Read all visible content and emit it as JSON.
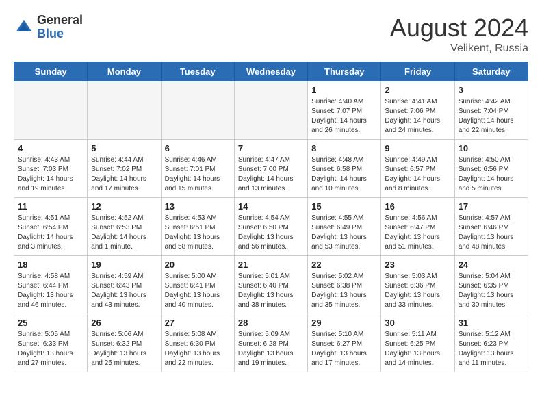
{
  "header": {
    "logo_general": "General",
    "logo_blue": "Blue",
    "title": "August 2024",
    "subtitle": "Velikent, Russia"
  },
  "weekdays": [
    "Sunday",
    "Monday",
    "Tuesday",
    "Wednesday",
    "Thursday",
    "Friday",
    "Saturday"
  ],
  "weeks": [
    [
      {
        "day": "",
        "sunrise": "",
        "sunset": "",
        "daylight": ""
      },
      {
        "day": "",
        "sunrise": "",
        "sunset": "",
        "daylight": ""
      },
      {
        "day": "",
        "sunrise": "",
        "sunset": "",
        "daylight": ""
      },
      {
        "day": "",
        "sunrise": "",
        "sunset": "",
        "daylight": ""
      },
      {
        "day": "1",
        "sunrise": "Sunrise: 4:40 AM",
        "sunset": "Sunset: 7:07 PM",
        "daylight": "Daylight: 14 hours and 26 minutes."
      },
      {
        "day": "2",
        "sunrise": "Sunrise: 4:41 AM",
        "sunset": "Sunset: 7:06 PM",
        "daylight": "Daylight: 14 hours and 24 minutes."
      },
      {
        "day": "3",
        "sunrise": "Sunrise: 4:42 AM",
        "sunset": "Sunset: 7:04 PM",
        "daylight": "Daylight: 14 hours and 22 minutes."
      }
    ],
    [
      {
        "day": "4",
        "sunrise": "Sunrise: 4:43 AM",
        "sunset": "Sunset: 7:03 PM",
        "daylight": "Daylight: 14 hours and 19 minutes."
      },
      {
        "day": "5",
        "sunrise": "Sunrise: 4:44 AM",
        "sunset": "Sunset: 7:02 PM",
        "daylight": "Daylight: 14 hours and 17 minutes."
      },
      {
        "day": "6",
        "sunrise": "Sunrise: 4:46 AM",
        "sunset": "Sunset: 7:01 PM",
        "daylight": "Daylight: 14 hours and 15 minutes."
      },
      {
        "day": "7",
        "sunrise": "Sunrise: 4:47 AM",
        "sunset": "Sunset: 7:00 PM",
        "daylight": "Daylight: 14 hours and 13 minutes."
      },
      {
        "day": "8",
        "sunrise": "Sunrise: 4:48 AM",
        "sunset": "Sunset: 6:58 PM",
        "daylight": "Daylight: 14 hours and 10 minutes."
      },
      {
        "day": "9",
        "sunrise": "Sunrise: 4:49 AM",
        "sunset": "Sunset: 6:57 PM",
        "daylight": "Daylight: 14 hours and 8 minutes."
      },
      {
        "day": "10",
        "sunrise": "Sunrise: 4:50 AM",
        "sunset": "Sunset: 6:56 PM",
        "daylight": "Daylight: 14 hours and 5 minutes."
      }
    ],
    [
      {
        "day": "11",
        "sunrise": "Sunrise: 4:51 AM",
        "sunset": "Sunset: 6:54 PM",
        "daylight": "Daylight: 14 hours and 3 minutes."
      },
      {
        "day": "12",
        "sunrise": "Sunrise: 4:52 AM",
        "sunset": "Sunset: 6:53 PM",
        "daylight": "Daylight: 14 hours and 1 minute."
      },
      {
        "day": "13",
        "sunrise": "Sunrise: 4:53 AM",
        "sunset": "Sunset: 6:51 PM",
        "daylight": "Daylight: 13 hours and 58 minutes."
      },
      {
        "day": "14",
        "sunrise": "Sunrise: 4:54 AM",
        "sunset": "Sunset: 6:50 PM",
        "daylight": "Daylight: 13 hours and 56 minutes."
      },
      {
        "day": "15",
        "sunrise": "Sunrise: 4:55 AM",
        "sunset": "Sunset: 6:49 PM",
        "daylight": "Daylight: 13 hours and 53 minutes."
      },
      {
        "day": "16",
        "sunrise": "Sunrise: 4:56 AM",
        "sunset": "Sunset: 6:47 PM",
        "daylight": "Daylight: 13 hours and 51 minutes."
      },
      {
        "day": "17",
        "sunrise": "Sunrise: 4:57 AM",
        "sunset": "Sunset: 6:46 PM",
        "daylight": "Daylight: 13 hours and 48 minutes."
      }
    ],
    [
      {
        "day": "18",
        "sunrise": "Sunrise: 4:58 AM",
        "sunset": "Sunset: 6:44 PM",
        "daylight": "Daylight: 13 hours and 46 minutes."
      },
      {
        "day": "19",
        "sunrise": "Sunrise: 4:59 AM",
        "sunset": "Sunset: 6:43 PM",
        "daylight": "Daylight: 13 hours and 43 minutes."
      },
      {
        "day": "20",
        "sunrise": "Sunrise: 5:00 AM",
        "sunset": "Sunset: 6:41 PM",
        "daylight": "Daylight: 13 hours and 40 minutes."
      },
      {
        "day": "21",
        "sunrise": "Sunrise: 5:01 AM",
        "sunset": "Sunset: 6:40 PM",
        "daylight": "Daylight: 13 hours and 38 minutes."
      },
      {
        "day": "22",
        "sunrise": "Sunrise: 5:02 AM",
        "sunset": "Sunset: 6:38 PM",
        "daylight": "Daylight: 13 hours and 35 minutes."
      },
      {
        "day": "23",
        "sunrise": "Sunrise: 5:03 AM",
        "sunset": "Sunset: 6:36 PM",
        "daylight": "Daylight: 13 hours and 33 minutes."
      },
      {
        "day": "24",
        "sunrise": "Sunrise: 5:04 AM",
        "sunset": "Sunset: 6:35 PM",
        "daylight": "Daylight: 13 hours and 30 minutes."
      }
    ],
    [
      {
        "day": "25",
        "sunrise": "Sunrise: 5:05 AM",
        "sunset": "Sunset: 6:33 PM",
        "daylight": "Daylight: 13 hours and 27 minutes."
      },
      {
        "day": "26",
        "sunrise": "Sunrise: 5:06 AM",
        "sunset": "Sunset: 6:32 PM",
        "daylight": "Daylight: 13 hours and 25 minutes."
      },
      {
        "day": "27",
        "sunrise": "Sunrise: 5:08 AM",
        "sunset": "Sunset: 6:30 PM",
        "daylight": "Daylight: 13 hours and 22 minutes."
      },
      {
        "day": "28",
        "sunrise": "Sunrise: 5:09 AM",
        "sunset": "Sunset: 6:28 PM",
        "daylight": "Daylight: 13 hours and 19 minutes."
      },
      {
        "day": "29",
        "sunrise": "Sunrise: 5:10 AM",
        "sunset": "Sunset: 6:27 PM",
        "daylight": "Daylight: 13 hours and 17 minutes."
      },
      {
        "day": "30",
        "sunrise": "Sunrise: 5:11 AM",
        "sunset": "Sunset: 6:25 PM",
        "daylight": "Daylight: 13 hours and 14 minutes."
      },
      {
        "day": "31",
        "sunrise": "Sunrise: 5:12 AM",
        "sunset": "Sunset: 6:23 PM",
        "daylight": "Daylight: 13 hours and 11 minutes."
      }
    ]
  ]
}
